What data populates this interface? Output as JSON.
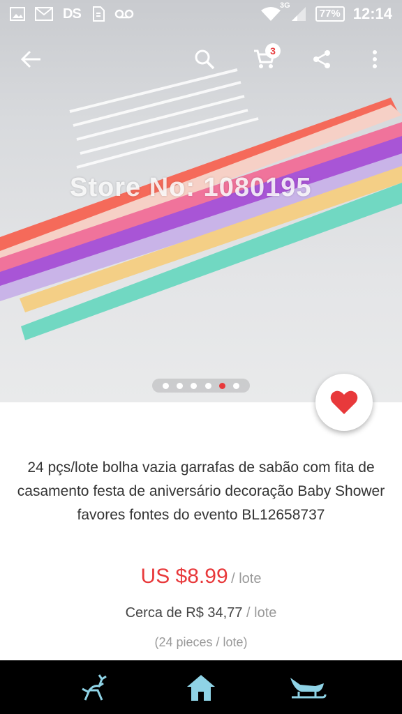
{
  "status_bar": {
    "left_icons": [
      "image-icon",
      "gmail-icon",
      "ds-icon",
      "sim-icon",
      "voicemail-icon"
    ],
    "ds_label": "DS",
    "network": "3G",
    "battery": "77%",
    "time": "12:14"
  },
  "app_bar": {
    "cart_count": "3"
  },
  "product": {
    "watermark": "Store No: 1080195",
    "image_pager": {
      "total": 6,
      "active_index": 4
    },
    "title": "24 pçs/lote bolha vazia garrafas de sabão com fita de casamento festa de aniversário decoração Baby Shower favores fontes do evento BL12658737",
    "price": "US $8.99",
    "price_unit": "/ lote",
    "approx_price": "Cerca de R$ 34,77",
    "approx_unit": "/ lote",
    "pieces": "(24 pieces / lote)"
  },
  "colors": {
    "accent": "#e8393b",
    "nav_icon": "#8fd3e6"
  },
  "bottom_nav": [
    "reindeer-icon",
    "house-icon",
    "sleigh-icon"
  ]
}
